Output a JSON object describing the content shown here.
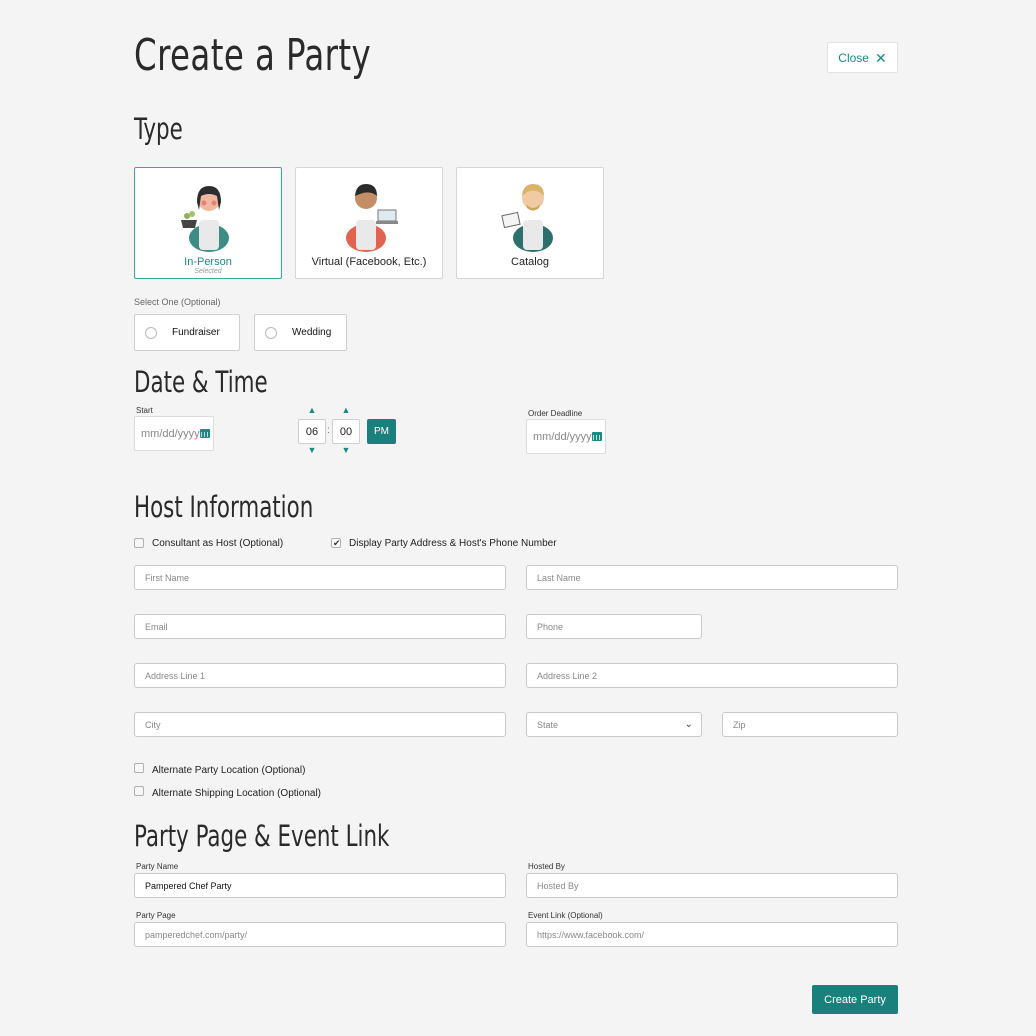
{
  "page": {
    "title": "Create a Party",
    "close_label": "Close"
  },
  "type_section": {
    "heading": "Type",
    "cards": [
      {
        "label": "In-Person",
        "selected_text": "Selected"
      },
      {
        "label": "Virtual (Facebook, Etc.)"
      },
      {
        "label": "Catalog"
      }
    ],
    "optional_label": "Select One (Optional)",
    "options": [
      {
        "label": "Fundraiser"
      },
      {
        "label": "Wedding"
      }
    ]
  },
  "date_time": {
    "heading": "Date & Time",
    "start_label": "Start",
    "start_placeholder": "mm/dd/yyyy",
    "hour": "06",
    "minute": "00",
    "separator": ":",
    "meridiem": "PM",
    "deadline_label": "Order Deadline",
    "deadline_placeholder": "mm/dd/yyyy"
  },
  "host": {
    "heading": "Host Information",
    "consultant_label": "Consultant as Host (Optional)",
    "display_label": "Display Party Address & Host's Phone Number",
    "first_name": "First Name",
    "last_name": "Last Name",
    "email": "Email",
    "phone": "Phone",
    "address1": "Address Line 1",
    "address2": "Address Line 2",
    "city": "City",
    "state": "State",
    "zip": "Zip",
    "alt_party_label": "Alternate Party Location (Optional)",
    "alt_ship_label": "Alternate Shipping Location (Optional)"
  },
  "party_page": {
    "heading": "Party Page & Event Link",
    "party_name_label": "Party Name",
    "party_name_value": "Pampered Chef Party",
    "hosted_by_label": "Hosted By",
    "hosted_by_placeholder": "Hosted By",
    "party_page_label": "Party Page",
    "party_page_placeholder": "pamperedchef.com/party/",
    "event_link_label": "Event Link (Optional)",
    "event_link_placeholder": "https://www.facebook.com/"
  },
  "submit_label": "Create Party",
  "colors": {
    "accent": "#1a807c",
    "background": "#f3f4f3"
  },
  "icons": [
    "close-icon",
    "calendar-icon",
    "chevron-up-icon",
    "chevron-down-icon",
    "checkmark-icon"
  ]
}
